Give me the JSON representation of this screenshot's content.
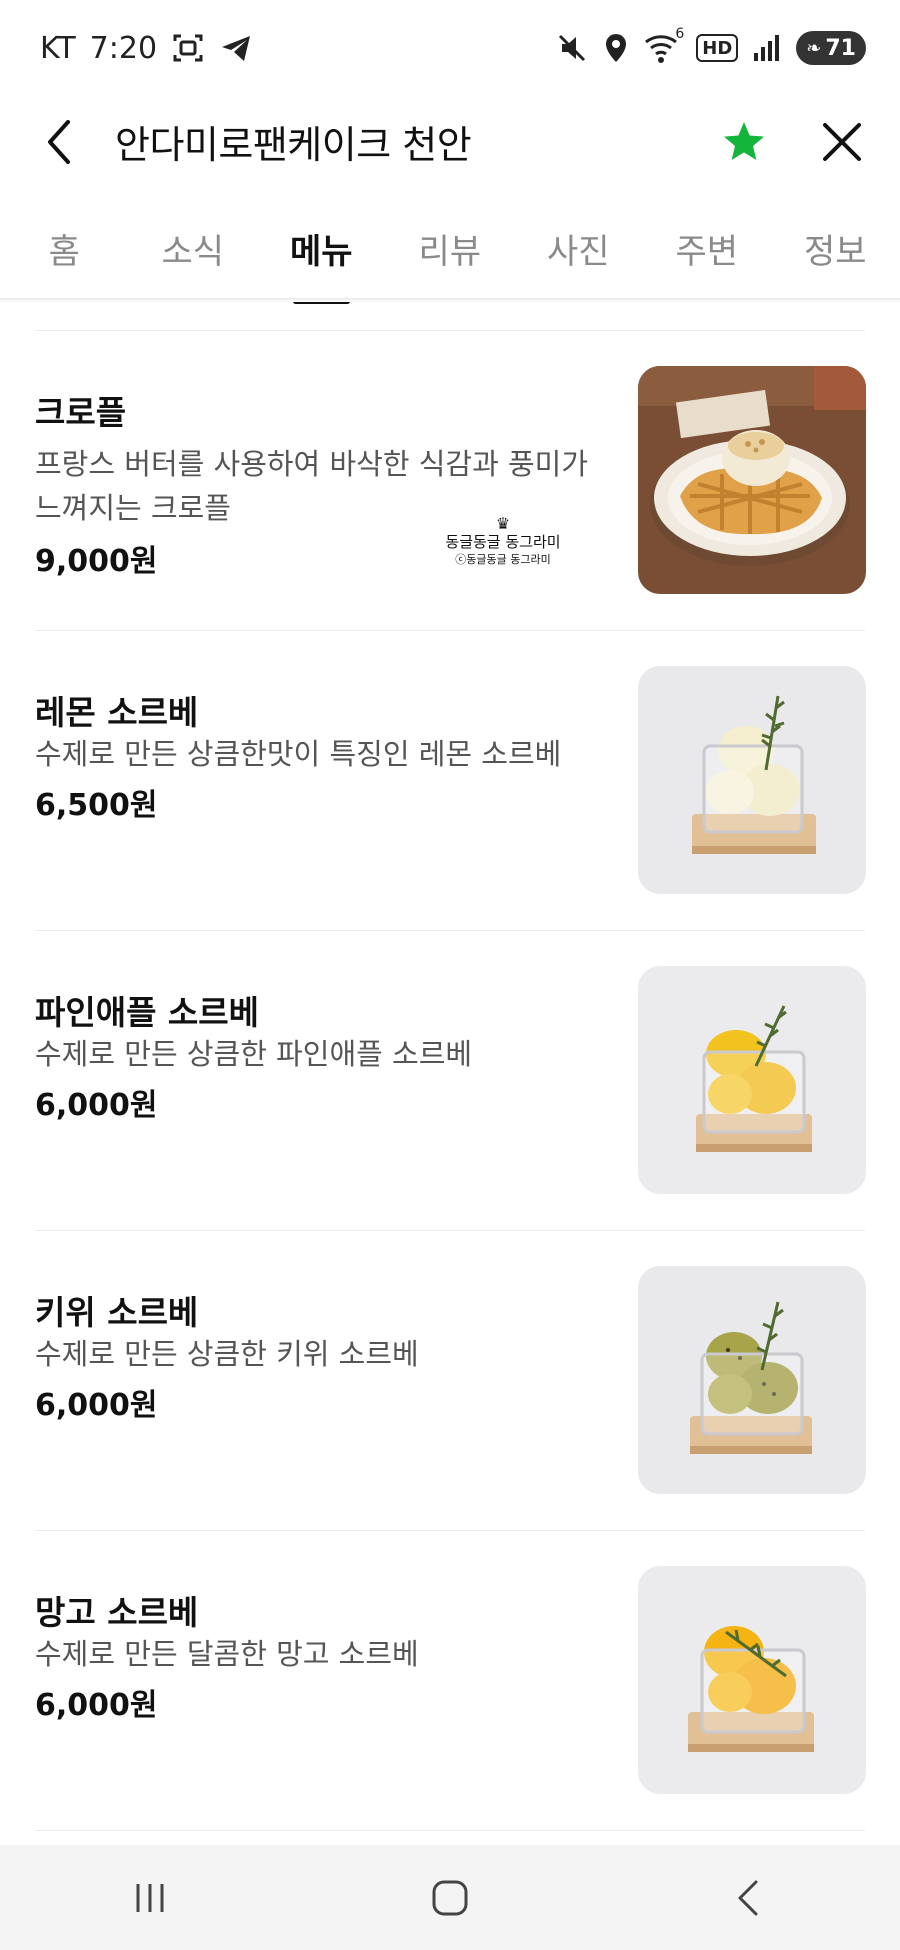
{
  "status_bar": {
    "carrier": "KT",
    "time": "7:20",
    "wifi_badge": "6",
    "hd_label": "HD",
    "battery": "71"
  },
  "header": {
    "title": "안다미로팬케이크 천안"
  },
  "tabs": [
    {
      "label": "홈"
    },
    {
      "label": "소식"
    },
    {
      "label": "메뉴"
    },
    {
      "label": "리뷰"
    },
    {
      "label": "사진"
    },
    {
      "label": "주변"
    },
    {
      "label": "정보"
    }
  ],
  "active_tab": "메뉴",
  "menu_items": [
    {
      "name": "크로플",
      "description": "프랑스 버터를 사용하여 바삭한 식감과 풍미가 느껴지는 크로플",
      "price": "9,000원",
      "photo": "croffle-with-ice-cream"
    },
    {
      "name": "레몬 소르베",
      "description": "수제로 만든 상큼한맛이 특징인 레몬 소르베",
      "price": "6,500원",
      "photo": "lemon-sorbet"
    },
    {
      "name": "파인애플 소르베",
      "description": "수제로 만든 상큼한 파인애플 소르베",
      "price": "6,000원",
      "photo": "pineapple-sorbet"
    },
    {
      "name": "키위 소르베",
      "description": "수제로 만든 상큼한 키위 소르베",
      "price": "6,000원",
      "photo": "kiwi-sorbet"
    },
    {
      "name": "망고 소르베",
      "description": "수제로 만든 달콤한 망고 소르베",
      "price": "6,000원",
      "photo": "mango-sorbet"
    }
  ],
  "watermark": {
    "line1": "동글동글 동그라미",
    "line2": "ⓒ동글동글 동그라미"
  },
  "colors": {
    "star_green": "#13b53a",
    "lemon_scoop": "#f5efcf",
    "pineapple_scoop": "#f2c21f",
    "kiwi_scoop": "#a7a44a",
    "mango_scoop": "#f5b413"
  }
}
